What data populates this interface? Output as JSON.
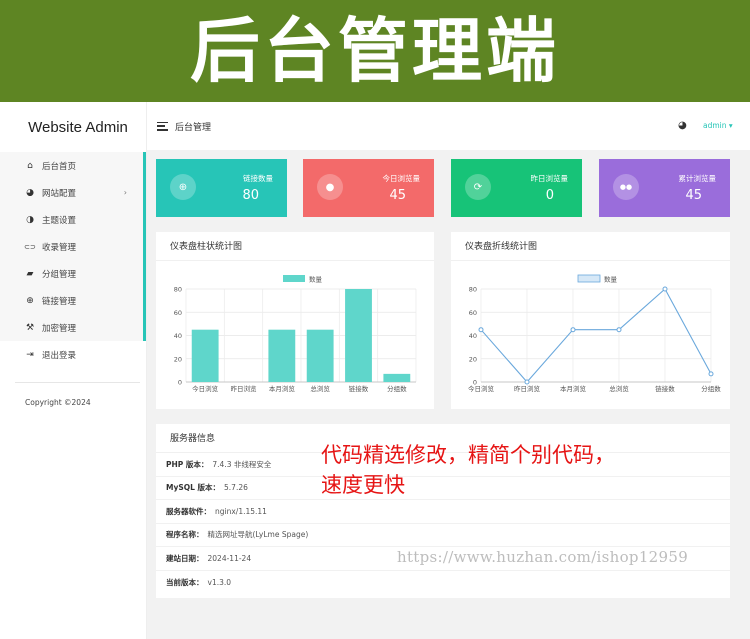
{
  "banner": {
    "title": "后台管理端"
  },
  "sidebar": {
    "brand": "Website Admin",
    "items": [
      {
        "label": "后台首页",
        "icon": "home-icon",
        "glyph": "⌂"
      },
      {
        "label": "网站配置",
        "icon": "palette-icon",
        "glyph": "◕",
        "has_submenu": true
      },
      {
        "label": "主题设置",
        "icon": "contrast-icon",
        "glyph": "◑"
      },
      {
        "label": "收录管理",
        "icon": "link-icon",
        "glyph": "⊂⊃"
      },
      {
        "label": "分组管理",
        "icon": "folder-icon",
        "glyph": "▰"
      },
      {
        "label": "链接管理",
        "icon": "globe-icon",
        "glyph": "⊕"
      },
      {
        "label": "加密管理",
        "icon": "wrench-icon",
        "glyph": "⚒"
      },
      {
        "label": "退出登录",
        "icon": "logout-icon",
        "glyph": "⇥"
      }
    ],
    "copyright": "Copyright ©2024"
  },
  "topbar": {
    "title": "后台管理",
    "user": "admin ▾"
  },
  "stats": [
    {
      "label": "链接数量",
      "value": "80",
      "icon": "globe-icon",
      "glyph": "⊕",
      "color": "#27c5b7"
    },
    {
      "label": "今日浏览量",
      "value": "45",
      "icon": "user-icon",
      "glyph": "●",
      "color": "#f36a6a"
    },
    {
      "label": "昨日浏览量",
      "value": "0",
      "icon": "refresh-icon",
      "glyph": "⟳",
      "color": "#17c378"
    },
    {
      "label": "累计浏览量",
      "value": "45",
      "icon": "users-icon",
      "glyph": "●●",
      "color": "#9a6ddb"
    }
  ],
  "charts": {
    "bar_title": "仪表盘柱状统计图",
    "line_title": "仪表盘折线统计图"
  },
  "chart_data": [
    {
      "type": "bar",
      "title": "仪表盘柱状统计图",
      "categories": [
        "今日浏览",
        "昨日浏览",
        "本月浏览",
        "总浏览",
        "链接数",
        "分组数"
      ],
      "series": [
        {
          "name": "数量",
          "values": [
            45,
            0,
            45,
            45,
            80,
            7
          ]
        }
      ],
      "ylim": [
        0,
        80
      ],
      "yticks": [
        0,
        20,
        40,
        60,
        80
      ],
      "grid": true,
      "legend": "top-center",
      "color": "#5fd6cb"
    },
    {
      "type": "line",
      "title": "仪表盘折线统计图",
      "categories": [
        "今日浏览",
        "昨日浏览",
        "本月浏览",
        "总浏览",
        "链接数",
        "分组数"
      ],
      "series": [
        {
          "name": "数量",
          "values": [
            45,
            0,
            45,
            45,
            80,
            7
          ]
        }
      ],
      "ylim": [
        0,
        80
      ],
      "yticks": [
        0,
        20,
        40,
        60,
        80
      ],
      "grid": true,
      "legend": "top-center",
      "color": "#6aa8dc"
    }
  ],
  "server_info": {
    "title": "服务器信息",
    "rows": [
      {
        "key": "PHP 版本：",
        "value": "7.4.3 非线程安全"
      },
      {
        "key": "MySQL 版本：",
        "value": "5.7.26"
      },
      {
        "key": "服务器软件：",
        "value": "nginx/1.15.11"
      },
      {
        "key": "程序名称：",
        "value": "精选网址导航(LyLme Spage)"
      },
      {
        "key": "建站日期：",
        "value": "2024-11-24"
      },
      {
        "key": "当前版本：",
        "value": "v1.3.0"
      }
    ]
  },
  "overlay": {
    "promo_line1": "代码精选修改，精简个别代码，",
    "promo_line2": "速度更快",
    "watermark": "https://www.huzhan.com/ishop12959"
  }
}
